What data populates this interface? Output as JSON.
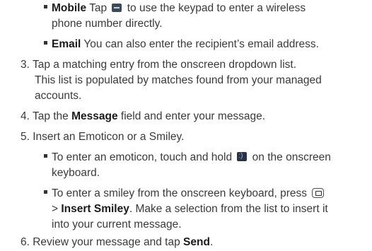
{
  "items": [
    {
      "bold": "Mobile",
      "pre": " Tap ",
      "icon": "keypad-button-icon",
      "post": " to use the keypad to enter a wireless"
    },
    {
      "text": "phone number directly."
    },
    {
      "bold": "Email",
      "post": " You can also enter the recipient’s email address."
    },
    {
      "text": "3. Tap a matching entry from the onscreen dropdown list."
    },
    {
      "text": "This list is populated by matches found from your managed"
    },
    {
      "text": "accounts."
    },
    {
      "pre": "4. Tap the ",
      "bold": "Message",
      "post": " field and enter your message."
    },
    {
      "text": "5. Insert an Emoticon or a Smiley."
    },
    {
      "pre": "To enter an emoticon, touch and hold ",
      "icon": "emoticon-key-icon",
      "post": " on the onscreen"
    },
    {
      "text": "keyboard."
    },
    {
      "pre": "To enter a smiley from the onscreen keyboard, press ",
      "icon": "menu-key-icon"
    },
    {
      "pre": "> ",
      "bold": "Insert Smiley",
      "post": ". Make a selection from the list to insert it"
    },
    {
      "text": "into your current message."
    },
    {
      "pre": "6. Review your message and tap ",
      "bold": "Send",
      "post": "."
    }
  ]
}
